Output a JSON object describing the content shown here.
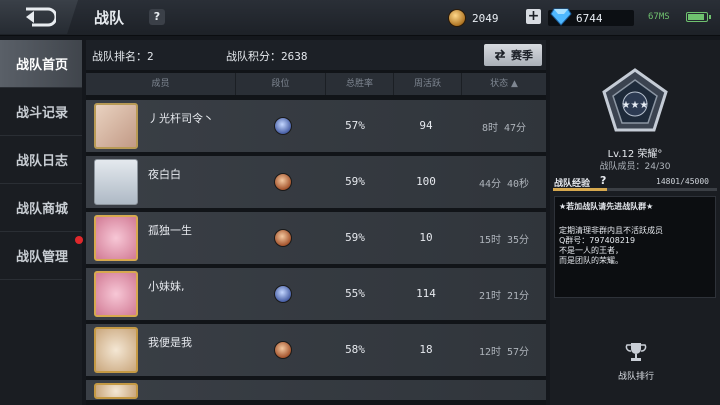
{
  "header": {
    "title": "战队",
    "help": "?",
    "coins": "2049",
    "gems": "6744",
    "ping": "67MS"
  },
  "nav": {
    "items": [
      {
        "label": "战队首页",
        "active": true
      },
      {
        "label": "战斗记录",
        "active": false
      },
      {
        "label": "战队日志",
        "active": false
      },
      {
        "label": "战队商城",
        "active": false
      },
      {
        "label": "战队管理",
        "active": false
      }
    ]
  },
  "main": {
    "rank_label": "战队排名：",
    "rank_value": "2",
    "points_label": "战队积分：",
    "points_value": "2638",
    "season_button": "赛季",
    "columns": [
      "成员",
      "段位",
      "总胜率",
      "周活跃",
      "状态 ▲"
    ],
    "members": [
      {
        "name": "丿光杆司令丶",
        "rank_badge": "blue",
        "win_rate": "57%",
        "weekly_active": "94",
        "status": "8时 47分",
        "avatar": "portrait-gold"
      },
      {
        "name": "夜白白",
        "rank_badge": "bronze",
        "win_rate": "59%",
        "weekly_active": "100",
        "status": "44分 40秒",
        "avatar": "plain"
      },
      {
        "name": "孤独一生",
        "rank_badge": "bronze",
        "win_rate": "59%",
        "weekly_active": "10",
        "status": "15时 35分",
        "avatar": "pink"
      },
      {
        "name": "小妹妹,",
        "rank_badge": "blue",
        "win_rate": "55%",
        "weekly_active": "114",
        "status": "21时 21分",
        "avatar": "pink"
      },
      {
        "name": "我便是我",
        "rank_badge": "bronze",
        "win_rate": "58%",
        "weekly_active": "18",
        "status": "12时 57分",
        "avatar": "cat"
      }
    ]
  },
  "team": {
    "level": "Lv.12 荣耀°",
    "members": "战队成员：24/30",
    "exp_label": "战队经验",
    "exp_help": "?",
    "exp_value": "14801/45000",
    "exp_fraction": 0.329,
    "notice_title": "★若加战队请先进战队群★",
    "notice_lines": [
      "定期清理非群内且不活跃成员",
      "Q群号：797408219",
      "不是一人的王者，",
      "而是团队的荣耀。"
    ],
    "ranking_button": "战队排行"
  }
}
